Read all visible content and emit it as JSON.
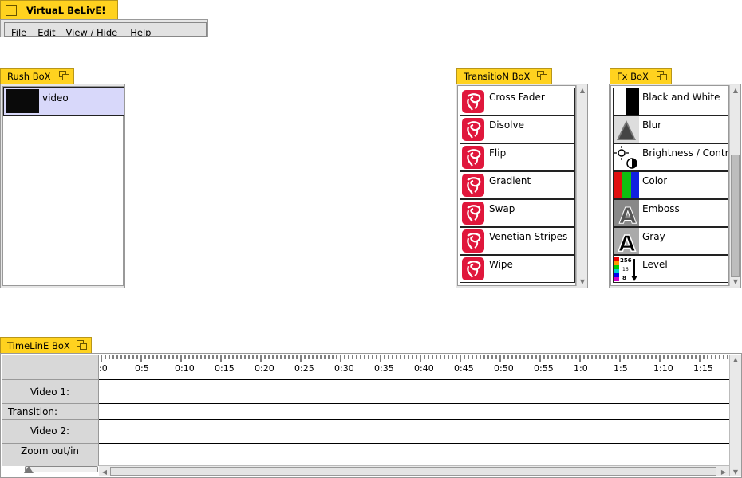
{
  "app": {
    "title": "VirtuaL BeLivE!"
  },
  "menu": {
    "items": [
      "File",
      "Edit",
      "View / Hide",
      "Help"
    ]
  },
  "rush": {
    "title": "Rush BoX",
    "items": [
      {
        "label": "video"
      }
    ]
  },
  "transition": {
    "title": "TransitioN BoX",
    "items": [
      {
        "label": "Cross Fader",
        "icon": "transition-swirl-icon"
      },
      {
        "label": "Disolve",
        "icon": "transition-swirl-icon"
      },
      {
        "label": "Flip",
        "icon": "transition-swirl-icon"
      },
      {
        "label": "Gradient",
        "icon": "transition-swirl-icon"
      },
      {
        "label": "Swap",
        "icon": "transition-swirl-icon"
      },
      {
        "label": "Venetian Stripes",
        "icon": "transition-swirl-icon"
      },
      {
        "label": "Wipe",
        "icon": "transition-swirl-icon"
      }
    ]
  },
  "fx": {
    "title": "Fx BoX",
    "items": [
      {
        "label": "Black and White",
        "icon": "black-white-icon"
      },
      {
        "label": "Blur",
        "icon": "blur-icon"
      },
      {
        "label": "Brightness / Contrast",
        "icon": "brightness-contrast-icon"
      },
      {
        "label": "Color",
        "icon": "color-bars-icon"
      },
      {
        "label": "Emboss",
        "icon": "emboss-icon"
      },
      {
        "label": "Gray",
        "icon": "gray-icon"
      },
      {
        "label": "Level",
        "icon": "level-icon",
        "icon_text": [
          "256",
          "16",
          "8"
        ]
      }
    ]
  },
  "timeline": {
    "title": "TimeLinE BoX",
    "ticks": [
      ":0",
      "0:5",
      "0:10",
      "0:15",
      "0:20",
      "0:25",
      "0:30",
      "0:35",
      "0:40",
      "0:45",
      "0:50",
      "0:55",
      "1:0",
      "1:5",
      "1:10",
      "1:15"
    ],
    "tracks": [
      "Video 1:",
      "Transition:",
      "Video 2:"
    ],
    "zoom_label": "Zoom out/in"
  },
  "colors": {
    "accent_tab": "#ffd21f",
    "selection": "#d8d8fa",
    "transition_icon": "#e0173c"
  }
}
